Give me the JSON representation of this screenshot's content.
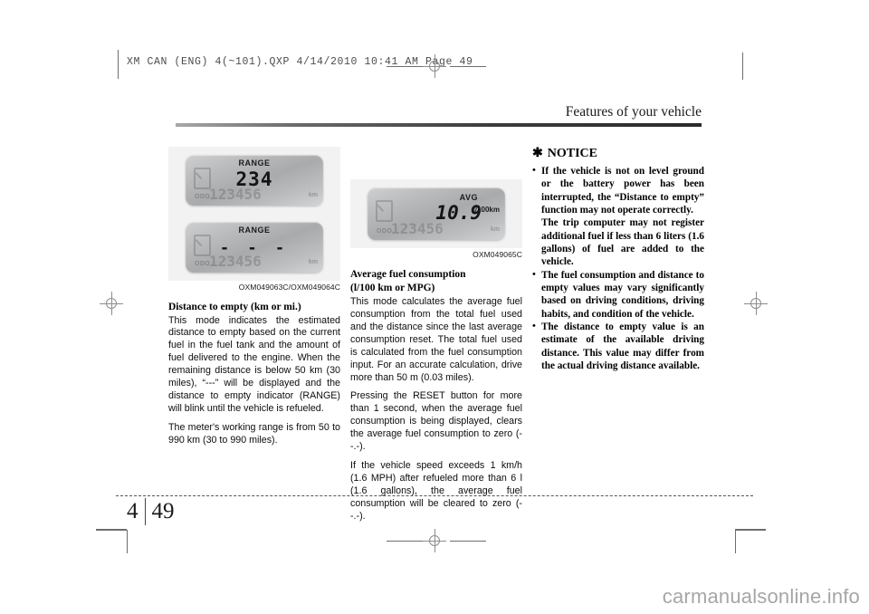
{
  "prepress": {
    "header": "XM CAN (ENG) 4(~101).QXP   4/14/2010   10:41 AM   Page 49"
  },
  "page": {
    "running_head": "Features of your vehicle",
    "chapter_number": "4",
    "page_number": "49"
  },
  "figures": [
    {
      "caption": "OXM049063C/OXM049064C",
      "panels": [
        {
          "label": "RANGE",
          "value": "234",
          "odo_label": "ODO",
          "odo_value": "123456",
          "odo_unit": "km"
        },
        {
          "label": "RANGE",
          "value": "- - -",
          "odo_label": "ODO",
          "odo_value": "123456",
          "odo_unit": "km"
        }
      ]
    },
    {
      "caption": "OXM049065C",
      "panels": [
        {
          "label": "AVG",
          "value": "10.9",
          "units": "ℓ/100km",
          "odo_label": "ODO",
          "odo_value": "123456",
          "odo_unit": "km"
        }
      ]
    }
  ],
  "sections": {
    "distance_to_empty": {
      "heading": "Distance to empty (km or mi.)",
      "paragraphs": [
        "This mode indicates the estimated distance to empty based on the current fuel in the fuel tank and the amount of fuel delivered to the engine. When the remaining distance is below 50 km (30 miles), “---” will be displayed and the distance to empty indicator (RANGE) will blink until the vehicle is refueled.",
        "The meter's working range is from 50 to 990 km (30 to 990 miles)."
      ]
    },
    "average_fuel_consumption": {
      "heading_line1": "Average fuel consumption",
      "heading_line2": "(l/100 km or MPG)",
      "paragraphs": [
        "This mode calculates the average fuel consumption from the total fuel used and the distance since the last average consumption reset. The total fuel used is calculated from the fuel consumption input. For an accurate calculation, drive more than 50 m (0.03 miles).",
        "Pressing the RESET button for more than 1 second, when the average fuel consumption is being displayed, clears the average fuel consumption to zero (--.-).",
        "If the vehicle speed exceeds 1 km/h (1.6 MPH) after refueled more than 6 l (1.6 gallons), the average fuel consumption will be cleared to zero (--.-)."
      ]
    },
    "notice": {
      "asterisk": "✱",
      "title": "NOTICE",
      "items": [
        "If the vehicle is not on level ground or the battery power has been interrupted, the “Distance to empty” function may not operate correctly.\nThe trip computer may not register additional fuel if less than 6 liters (1.6 gallons) of fuel are added to the vehicle.",
        "The fuel consumption and distance to empty values may vary significantly based on driving conditions, driving habits, and condition of the vehicle.",
        "The distance to empty value is an estimate of the available driving distance. This value may differ from the actual driving distance available."
      ]
    }
  },
  "watermark": {
    "text": "carmanualsonline.info"
  }
}
